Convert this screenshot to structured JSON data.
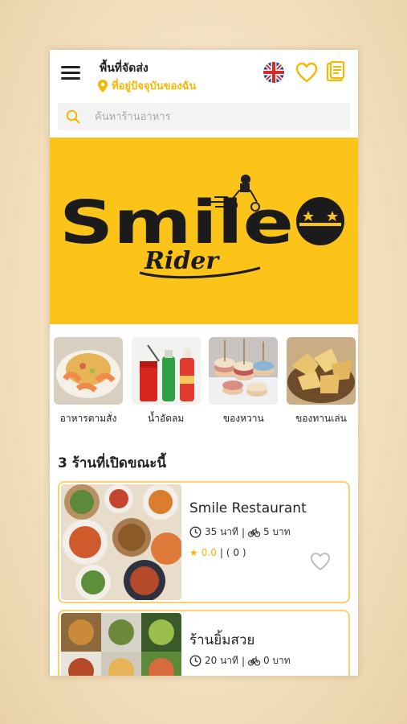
{
  "header": {
    "area_title": "พื้นที่จัดส่ง",
    "location": "ที่อยู่ปัจจุบันของฉัน",
    "icons": [
      "menu-icon",
      "location-pin-icon",
      "uk-flag-icon",
      "heart-icon",
      "orders-book-icon"
    ]
  },
  "search": {
    "placeholder": "ค้นหาร้านอาหาร",
    "value": ""
  },
  "banner": {
    "brand": "Smile",
    "sub": "Rider",
    "color": "#fcc419"
  },
  "categories": [
    {
      "label": "อาหารตามสั่ง"
    },
    {
      "label": "น้ำอัดลม"
    },
    {
      "label": "ของหวาน"
    },
    {
      "label": "ของทานเล่น"
    }
  ],
  "section_title": "3 ร้านที่เปิดขณะนี้",
  "restaurants": [
    {
      "name": "Smile Restaurant",
      "time": "35 นาที",
      "separator": "|",
      "fee": "5 บาท",
      "rating": "0.0",
      "rating_sep": "|",
      "reviews": "( 0 )"
    },
    {
      "name": "ร้านยิ้มสวย",
      "time": "20 นาที",
      "separator": "|",
      "fee": "0 บาท"
    }
  ],
  "colors": {
    "accent": "#f5b800",
    "card_border": "#f6d36a",
    "background": "#f3e2c3"
  }
}
